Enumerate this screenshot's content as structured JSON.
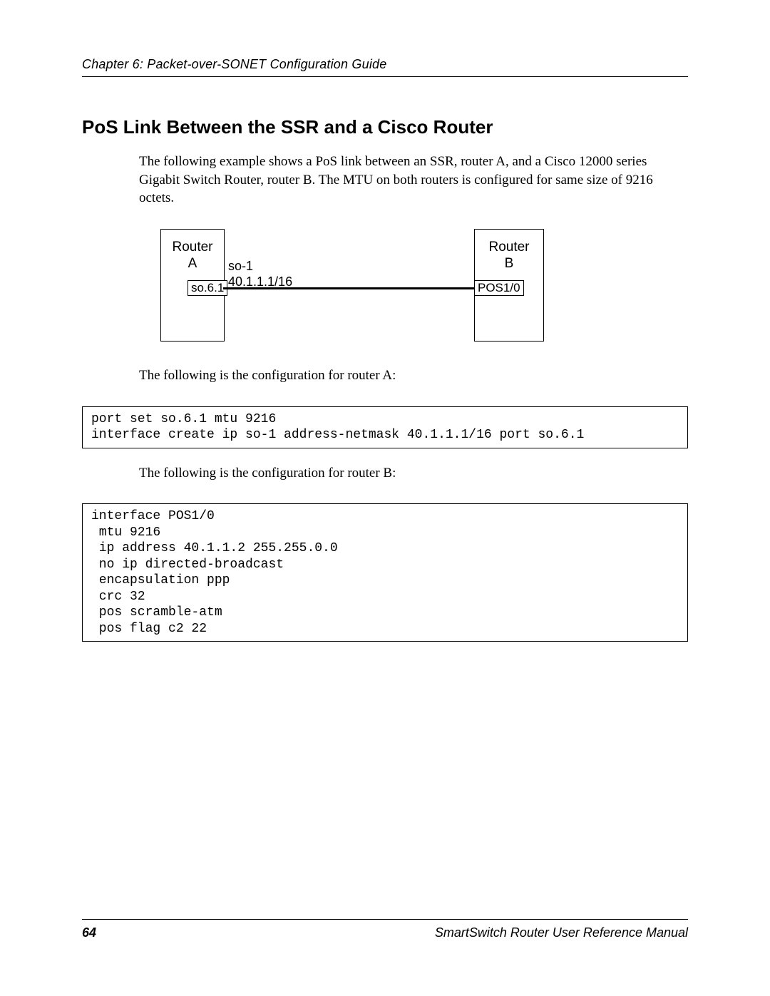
{
  "header": {
    "chapter_line": "Chapter 6: Packet-over-SONET Configuration Guide"
  },
  "section": {
    "title": "PoS Link Between the SSR and a Cisco Router",
    "intro": "The following example shows a PoS link between an SSR, router A, and a Cisco 12000 series Gigabit Switch Router, router B. The MTU on both routers is configured for same size of 9216 octets."
  },
  "diagram": {
    "router_a_name": "Router\nA",
    "router_b_name": "Router\nB",
    "port_a": "so.6.1",
    "port_b": "POS1/0",
    "link_name": "so-1",
    "link_address": "40.1.1.1/16"
  },
  "config_a": {
    "lead": "The following is the configuration for router A:",
    "code": "port set so.6.1 mtu 9216\ninterface create ip so-1 address-netmask 40.1.1.1/16 port so.6.1"
  },
  "config_b": {
    "lead": "The following is the configuration for router B:",
    "code": "interface POS1/0\n mtu 9216\n ip address 40.1.1.2 255.255.0.0\n no ip directed-broadcast\n encapsulation ppp\n crc 32\n pos scramble-atm\n pos flag c2 22"
  },
  "footer": {
    "page_number": "64",
    "manual": "SmartSwitch Router User Reference Manual"
  }
}
